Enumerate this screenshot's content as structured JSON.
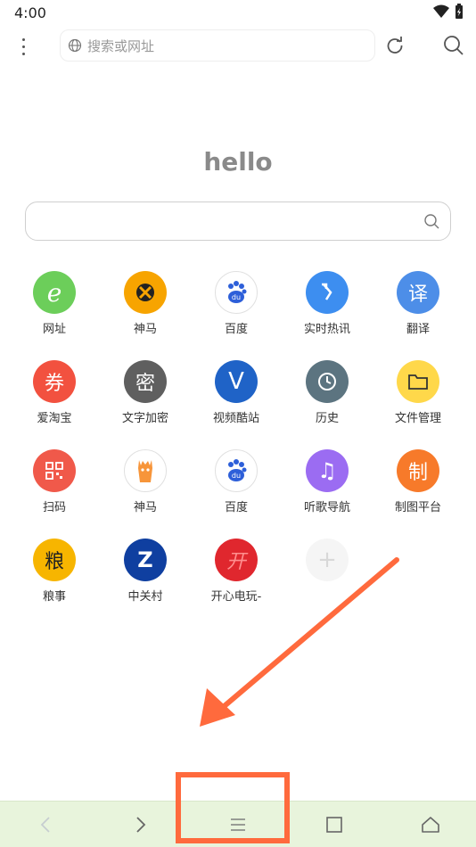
{
  "status": {
    "time": "4:00"
  },
  "toolbar": {
    "url_placeholder": "搜索或网址"
  },
  "home": {
    "greeting": "hello",
    "search_placeholder": ""
  },
  "shortcuts": [
    {
      "label": "网址",
      "glyph": "e",
      "color": "#6cce5a"
    },
    {
      "label": "神马",
      "glyph": "",
      "color": "#f7a400"
    },
    {
      "label": "百度",
      "glyph": "du",
      "color": "#ffffff"
    },
    {
      "label": "实时热讯",
      "glyph": "",
      "color": "#3d8ef0"
    },
    {
      "label": "翻译",
      "glyph": "译",
      "color": "#4d8ee8"
    },
    {
      "label": "爱淘宝",
      "glyph": "券",
      "color": "#f2513f"
    },
    {
      "label": "文字加密",
      "glyph": "密",
      "color": "#5f5f5f"
    },
    {
      "label": "视频酷站",
      "glyph": "V",
      "color": "#1f63c7"
    },
    {
      "label": "历史",
      "glyph": "",
      "color": "#5c7480"
    },
    {
      "label": "文件管理",
      "glyph": "",
      "color": "#ffd84a"
    },
    {
      "label": "扫码",
      "glyph": "",
      "color": "#f0594a"
    },
    {
      "label": "神马",
      "glyph": "",
      "color": "#ffffff"
    },
    {
      "label": "百度",
      "glyph": "du",
      "color": "#ffffff"
    },
    {
      "label": "听歌导航",
      "glyph": "♫",
      "color": "#9b6cf2"
    },
    {
      "label": "制图平台",
      "glyph": "制",
      "color": "#f77a2a"
    },
    {
      "label": "粮事",
      "glyph": "粮",
      "color": "#f7b500"
    },
    {
      "label": "中关村",
      "glyph": "Z",
      "color": "#0f3fa0"
    },
    {
      "label": "开心电玩-",
      "glyph": "开",
      "color": "#e0272e"
    },
    {
      "label": "",
      "glyph": "+",
      "color": "#f5f5f5"
    }
  ],
  "colors": {
    "accent": "#ff6a3d",
    "nav_bg": "#e8f4dc"
  },
  "nav": [
    "back-icon",
    "forward-icon",
    "menu-icon",
    "tabs-icon",
    "home-icon"
  ]
}
